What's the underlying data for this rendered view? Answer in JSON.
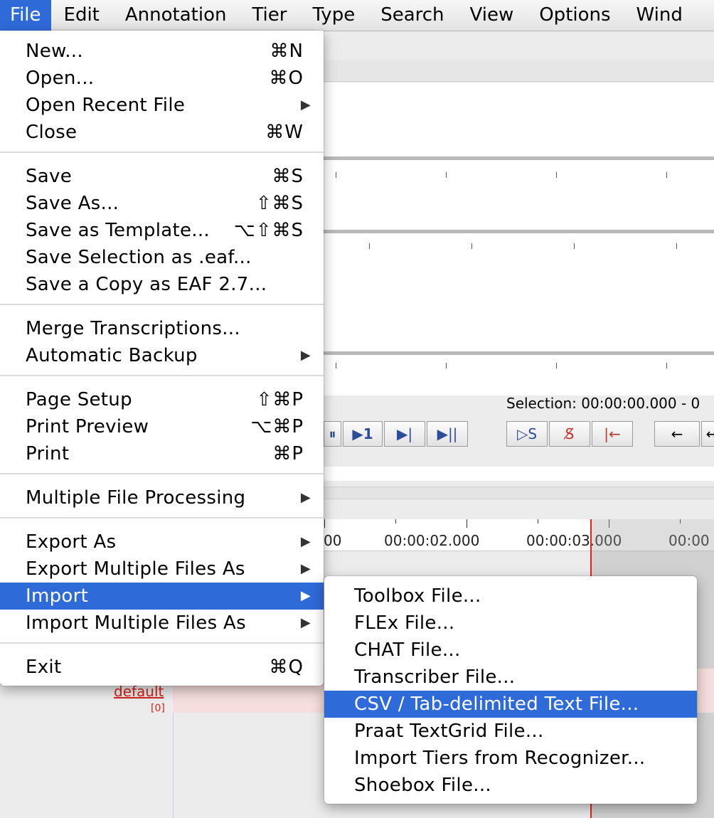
{
  "menubar": {
    "items": [
      "File",
      "Edit",
      "Annotation",
      "Tier",
      "Type",
      "Search",
      "View",
      "Options",
      "Wind"
    ]
  },
  "file_menu": {
    "new": {
      "label": "New...",
      "shortcut": "⌘N"
    },
    "open": {
      "label": "Open...",
      "shortcut": "⌘O"
    },
    "open_recent": {
      "label": "Open Recent File"
    },
    "close": {
      "label": "Close",
      "shortcut": "⌘W"
    },
    "save": {
      "label": "Save",
      "shortcut": "⌘S"
    },
    "save_as": {
      "label": "Save As...",
      "shortcut": "⇧⌘S"
    },
    "save_template": {
      "label": "Save as Template...",
      "shortcut": "⌥⇧⌘S"
    },
    "save_selection": {
      "label": "Save Selection as .eaf..."
    },
    "save_copy": {
      "label": "Save a Copy as EAF 2.7..."
    },
    "merge": {
      "label": "Merge Transcriptions..."
    },
    "backup": {
      "label": "Automatic Backup"
    },
    "page_setup": {
      "label": "Page Setup",
      "shortcut": "⇧⌘P"
    },
    "print_preview": {
      "label": "Print Preview",
      "shortcut": "⌥⌘P"
    },
    "print": {
      "label": "Print",
      "shortcut": "⌘P"
    },
    "multi_processing": {
      "label": "Multiple File Processing"
    },
    "export_as": {
      "label": "Export As"
    },
    "export_multi": {
      "label": "Export Multiple Files As"
    },
    "import": {
      "label": "Import"
    },
    "import_multi": {
      "label": "Import Multiple Files As"
    },
    "exit": {
      "label": "Exit",
      "shortcut": "⌘Q"
    }
  },
  "import_submenu": {
    "items": [
      "Toolbox File...",
      "FLEx File...",
      "CHAT File...",
      "Transcriber File...",
      "CSV / Tab-delimited Text File...",
      "Praat TextGrid File...",
      "Import Tiers from Recognizer...",
      "Shoebox File..."
    ],
    "highlighted_index": 4
  },
  "background": {
    "selection_text": "Selection: 00:00:00.000 - 0",
    "ruler_labels": [
      "00",
      "00:00:02.000",
      "00:00:03.000",
      "00:00"
    ],
    "tier_name": "default",
    "tier_count": "[0]"
  },
  "colors": {
    "highlight": "#2f6ad9",
    "crosshair": "#e2231a"
  }
}
